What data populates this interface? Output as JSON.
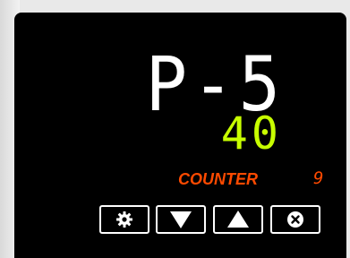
{
  "display": {
    "main_value": "P-5",
    "sub_value": "40",
    "label": "COUNTER",
    "count": "9"
  },
  "colors": {
    "main": "#ffffff",
    "sub": "#c8ff00",
    "accent": "#ff4a00",
    "panel": "#000000"
  },
  "buttons": [
    {
      "icon": "gear-icon"
    },
    {
      "icon": "triangle-down-icon"
    },
    {
      "icon": "triangle-up-icon"
    },
    {
      "icon": "close-circle-icon"
    }
  ]
}
